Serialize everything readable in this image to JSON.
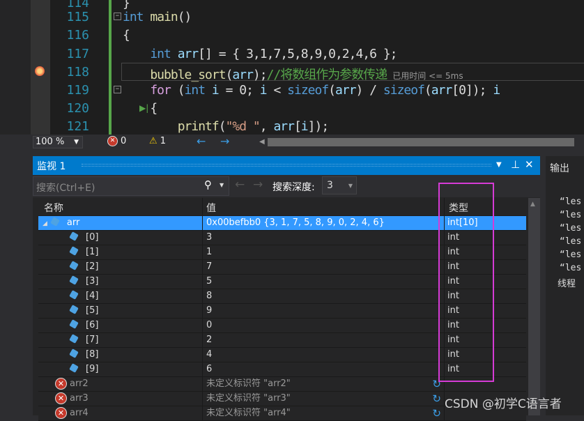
{
  "editor": {
    "line_numbers": [
      "114",
      "115",
      "116",
      "117",
      "118",
      "119",
      "120",
      "121"
    ],
    "lines": [
      [
        {
          "t": "}",
          "c": "#dcdcdc"
        }
      ],
      [
        {
          "t": "int",
          "c": "#569cd6"
        },
        {
          "t": " main",
          "c": "#dcdcaa"
        },
        {
          "t": "()",
          "c": "#dcdcdc"
        }
      ],
      [
        {
          "t": "{",
          "c": "#dcdcdc"
        }
      ],
      [
        {
          "t": "    int",
          "c": "#569cd6"
        },
        {
          "t": " arr",
          "c": "#9cdcfe"
        },
        {
          "t": "[] = { 3,1,7,5,8,9,0,2,4,6 };",
          "c": "#dcdcdc"
        }
      ],
      [
        {
          "t": "    bubble_sort",
          "c": "#dcdcaa"
        },
        {
          "t": "(",
          "c": "#dcdcdc"
        },
        {
          "t": "arr",
          "c": "#9cdcfe"
        },
        {
          "t": ");",
          "c": "#dcdcdc"
        },
        {
          "t": "//将数组作为参数传递",
          "c": "#57a64a"
        }
      ],
      [
        {
          "t": "    for",
          "c": "#d8a0df"
        },
        {
          "t": " (",
          "c": "#dcdcdc"
        },
        {
          "t": "int",
          "c": "#569cd6"
        },
        {
          "t": " i",
          "c": "#9cdcfe"
        },
        {
          "t": " = 0; ",
          "c": "#dcdcdc"
        },
        {
          "t": "i",
          "c": "#9cdcfe"
        },
        {
          "t": " < ",
          "c": "#dcdcdc"
        },
        {
          "t": "sizeof",
          "c": "#569cd6"
        },
        {
          "t": "(",
          "c": "#dcdcdc"
        },
        {
          "t": "arr",
          "c": "#9cdcfe"
        },
        {
          "t": ") / ",
          "c": "#dcdcdc"
        },
        {
          "t": "sizeof",
          "c": "#569cd6"
        },
        {
          "t": "(",
          "c": "#dcdcdc"
        },
        {
          "t": "arr",
          "c": "#9cdcfe"
        },
        {
          "t": "[0]); ",
          "c": "#dcdcdc"
        },
        {
          "t": "i",
          "c": "#9cdcfe"
        }
      ],
      [
        {
          "t": "    {",
          "c": "#dcdcdc"
        }
      ],
      [
        {
          "t": "        printf",
          "c": "#dcdcaa"
        },
        {
          "t": "(",
          "c": "#dcdcdc"
        },
        {
          "t": "\"%d \"",
          "c": "#d69d85"
        },
        {
          "t": ", ",
          "c": "#dcdcdc"
        },
        {
          "t": "arr",
          "c": "#9cdcfe"
        },
        {
          "t": "[",
          "c": "#dcdcdc"
        },
        {
          "t": "i",
          "c": "#9cdcfe"
        },
        {
          "t": "]);",
          "c": "#dcdcdc"
        }
      ]
    ],
    "timing_hint": "已用时间 <= 5ms"
  },
  "status": {
    "zoom": "100 %",
    "errors": "0",
    "warnings": "1"
  },
  "watch": {
    "title": "监视 1",
    "search_placeholder": "搜索(Ctrl+E)",
    "depth_label": "搜索深度:",
    "depth_value": "3",
    "columns": {
      "name": "名称",
      "value": "值",
      "type": "类型"
    },
    "rows": [
      {
        "name": "arr",
        "value": "0x00befbb0 {3, 1, 7, 5, 8, 9, 0, 2, 4, 6}",
        "type": "int[10]"
      },
      {
        "name": "[0]",
        "value": "3",
        "type": "int"
      },
      {
        "name": "[1]",
        "value": "1",
        "type": "int"
      },
      {
        "name": "[2]",
        "value": "7",
        "type": "int"
      },
      {
        "name": "[3]",
        "value": "5",
        "type": "int"
      },
      {
        "name": "[4]",
        "value": "8",
        "type": "int"
      },
      {
        "name": "[5]",
        "value": "9",
        "type": "int"
      },
      {
        "name": "[6]",
        "value": "0",
        "type": "int"
      },
      {
        "name": "[7]",
        "value": "2",
        "type": "int"
      },
      {
        "name": "[8]",
        "value": "4",
        "type": "int"
      },
      {
        "name": "[9]",
        "value": "6",
        "type": "int"
      }
    ],
    "error_rows": [
      {
        "name": "arr2",
        "value": "未定义标识符 \"arr2\""
      },
      {
        "name": "arr3",
        "value": "未定义标识符 \"arr3\""
      },
      {
        "name": "arr4",
        "value": "未定义标识符 \"arr4\""
      }
    ]
  },
  "output": {
    "title": "输出",
    "lines": [
      "“les",
      "“les",
      "“les",
      "“les",
      "“les",
      "“les",
      "线程"
    ]
  },
  "watermark": "CSDN @初学C语言者",
  "colors": {
    "accent": "#007acc",
    "selection": "#3399ff",
    "highlight_box": "#d63bd6"
  }
}
